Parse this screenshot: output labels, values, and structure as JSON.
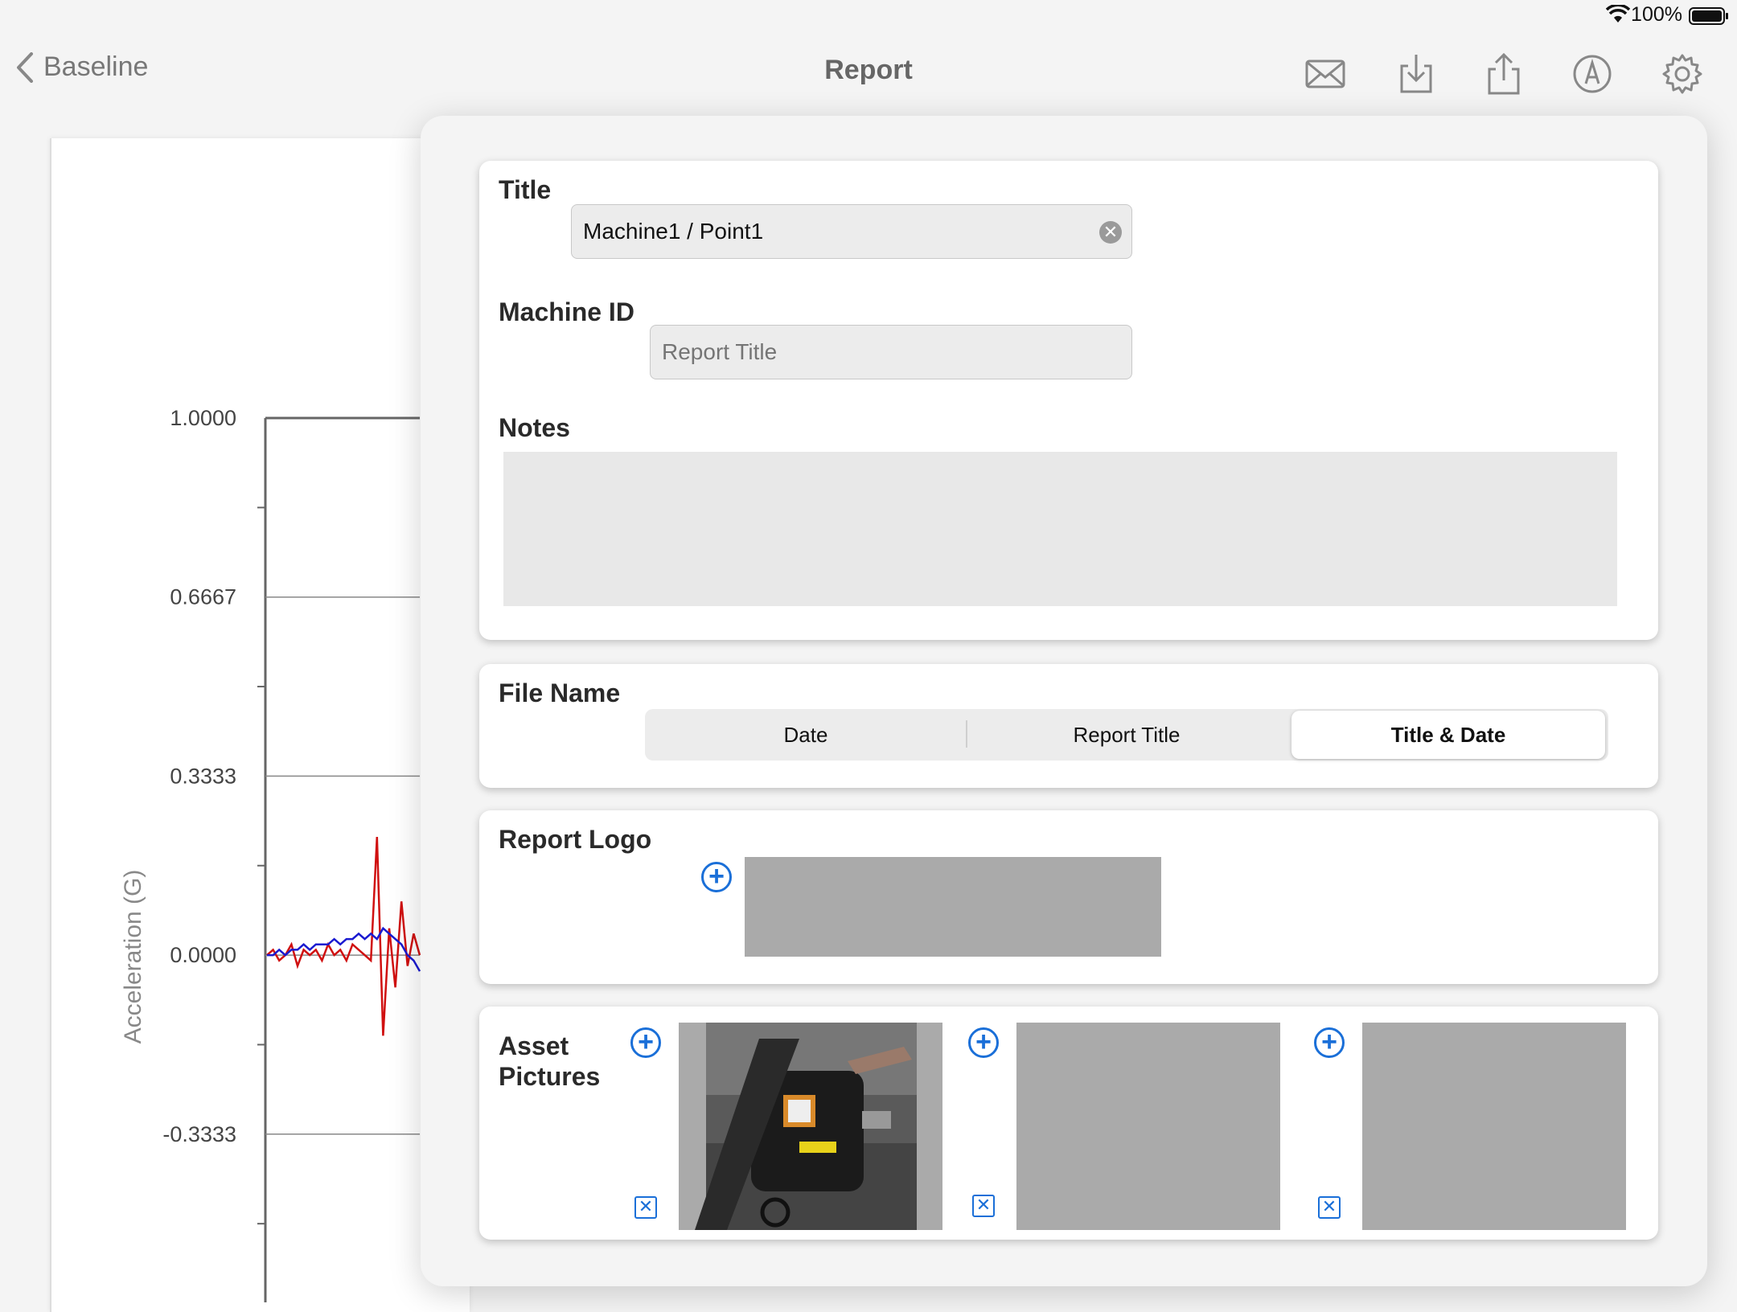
{
  "status_bar": {
    "battery_percent": "100%",
    "wifi_icon": "wifi-icon",
    "battery_icon": "battery-icon"
  },
  "nav": {
    "back_label": "Baseline",
    "title": "Report",
    "icons": [
      "mail-icon",
      "download-icon",
      "share-icon",
      "markup-icon",
      "gear-icon"
    ]
  },
  "chart_data": {
    "type": "line",
    "ylabel": "Acceleration (G)",
    "y_ticks": [
      "1.0000",
      "0.6667",
      "0.3333",
      "0.0000",
      "-0.3333"
    ],
    "ylim": [
      -0.5,
      1.0
    ],
    "series": [
      {
        "color": "#d01010",
        "values": [
          0.0,
          0.01,
          -0.01,
          0.0,
          0.02,
          -0.02,
          0.01,
          0.0,
          0.01,
          -0.01,
          0.02,
          0.0,
          0.01,
          -0.01,
          0.02,
          0.01,
          0.0,
          -0.01,
          0.22,
          -0.15,
          0.05,
          -0.06,
          0.1,
          -0.02,
          0.04,
          0.0
        ]
      },
      {
        "color": "#1a1ad0",
        "values": [
          0.0,
          0.0,
          0.01,
          0.0,
          0.01,
          0.01,
          0.02,
          0.01,
          0.02,
          0.02,
          0.02,
          0.03,
          0.02,
          0.03,
          0.03,
          0.04,
          0.03,
          0.04,
          0.03,
          0.05,
          0.04,
          0.03,
          0.02,
          0.0,
          -0.01,
          -0.03
        ]
      }
    ]
  },
  "form": {
    "title_label": "Title",
    "title_value": "Machine1 / Point1",
    "clear_symbol": "✕",
    "machine_id_label": "Machine ID",
    "machine_id_placeholder": "Report Title",
    "machine_id_value": "",
    "notes_label": "Notes",
    "notes_value": "",
    "file_name_label": "File Name",
    "file_name_options": [
      "Date",
      "Report Title",
      "Title & Date"
    ],
    "file_name_selected": "Title & Date",
    "report_logo_label": "Report Logo",
    "asset_pictures_label": "Asset\nPictures",
    "add_symbol": "+",
    "remove_symbol": "✕"
  }
}
